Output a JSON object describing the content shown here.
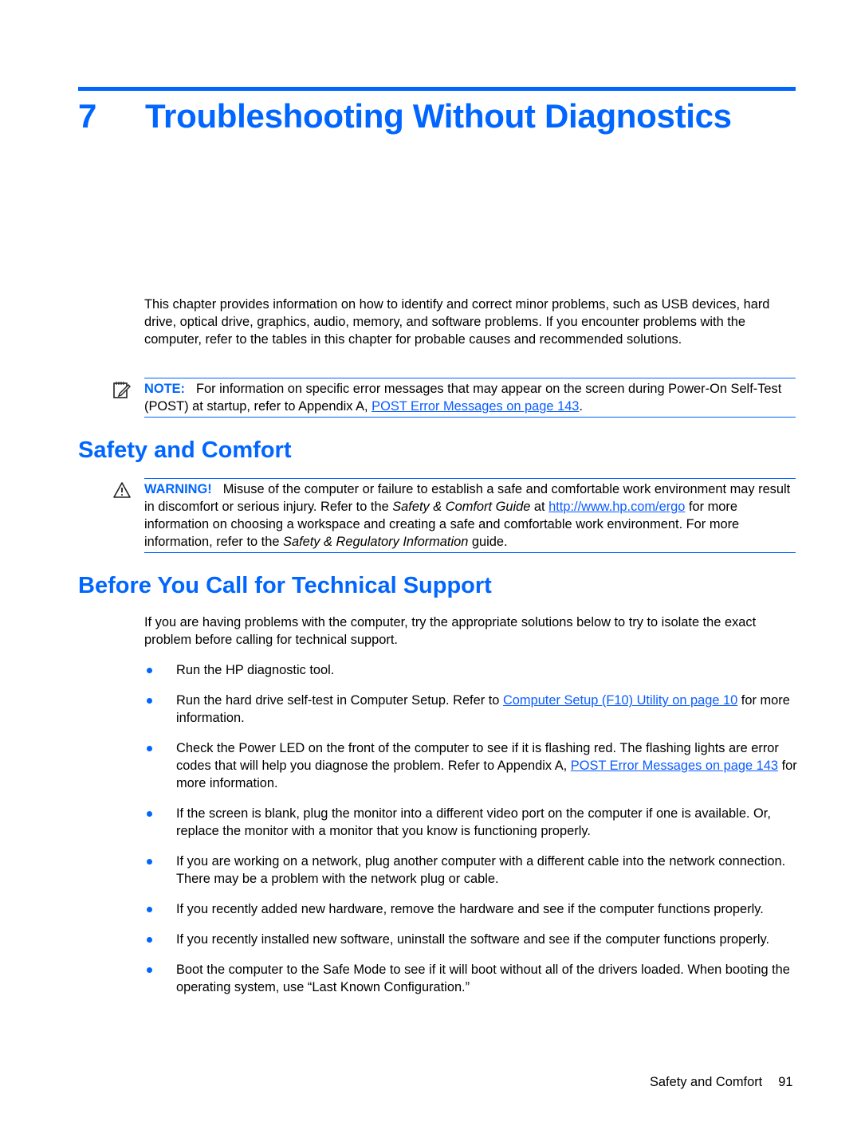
{
  "chapter": {
    "number": "7",
    "title": "Troubleshooting Without Diagnostics"
  },
  "intro": "This chapter provides information on how to identify and correct minor problems, such as USB devices, hard drive, optical drive, graphics, audio, memory, and software problems. If you encounter problems with the computer, refer to the tables in this chapter for probable causes and recommended solutions.",
  "note": {
    "icon": "note-pencil-icon",
    "label": "NOTE:",
    "text_before": "For information on specific error messages that may appear on the screen during Power-On Self-Test (POST) at startup, refer to Appendix A, ",
    "link": "POST Error Messages on page 143",
    "text_after": "."
  },
  "safety": {
    "heading": "Safety and Comfort",
    "warning": {
      "icon": "warning-triangle-icon",
      "label": "WARNING!",
      "text1": "Misuse of the computer or failure to establish a safe and comfortable work environment may result in discomfort or serious injury. Refer to the ",
      "italic1": "Safety & Comfort Guide",
      "text2": " at ",
      "link": "http://www.hp.com/ergo",
      "text3": " for more information on choosing a workspace and creating a safe and comfortable work environment. For more information, refer to the ",
      "italic2": "Safety & Regulatory Information",
      "text4": " guide."
    }
  },
  "before_support": {
    "heading": "Before You Call for Technical Support",
    "intro": "If you are having problems with the computer, try the appropriate solutions below to try to isolate the exact problem before calling for technical support.",
    "items": [
      {
        "text": "Run the HP diagnostic tool."
      },
      {
        "text": "Run the hard drive self-test in Computer Setup. Refer to ",
        "link": "Computer Setup (F10) Utility on page 10",
        "after": " for more information."
      },
      {
        "text": "Check the Power LED on the front of the computer to see if it is flashing red. The flashing lights are error codes that will help you diagnose the problem. Refer to Appendix A, ",
        "link": "POST Error Messages on page 143",
        "after": " for more information."
      },
      {
        "text": "If the screen is blank, plug the monitor into a different video port on the computer if one is available. Or, replace the monitor with a monitor that you know is functioning properly."
      },
      {
        "text": "If you are working on a network, plug another computer with a different cable into the network connection. There may be a problem with the network plug or cable."
      },
      {
        "text": "If you recently added new hardware, remove the hardware and see if the computer functions properly."
      },
      {
        "text": "If you recently installed new software, uninstall the software and see if the computer functions properly."
      },
      {
        "text": "Boot the computer to the Safe Mode to see if it will boot without all of the drivers loaded. When booting the operating system, use “Last Known Configuration.”"
      }
    ]
  },
  "footer": {
    "section": "Safety and Comfort",
    "page": "91"
  },
  "colors": {
    "accent": "#0066ff",
    "link": "#0b5cff"
  }
}
